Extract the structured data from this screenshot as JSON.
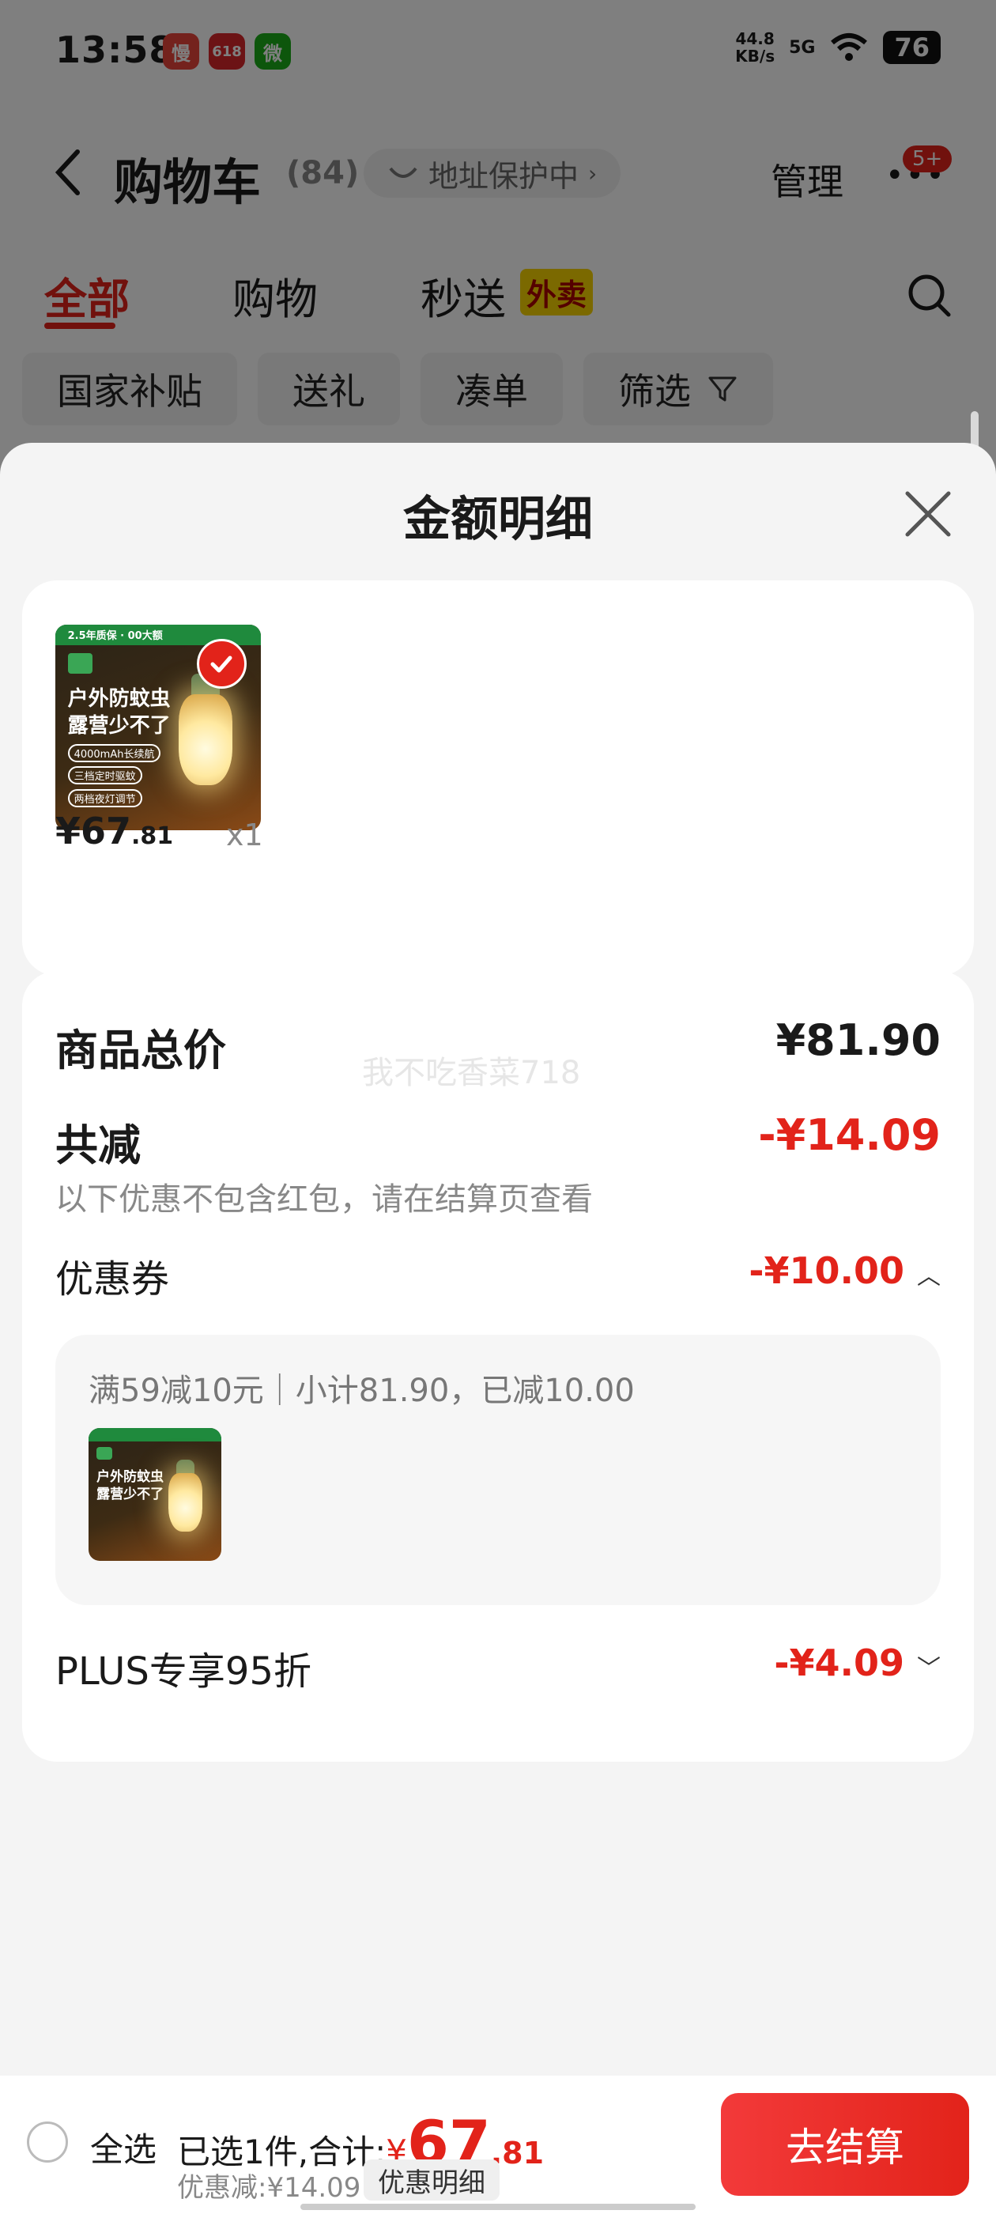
{
  "status_bar": {
    "time": "13:58",
    "apps": [
      {
        "icon": "manman-app-icon",
        "label": "慢",
        "color": "#e8443a"
      },
      {
        "icon": "jd-618-app-icon",
        "label": "618",
        "color": "#d8262b"
      },
      {
        "icon": "wechat-icon",
        "label": "微",
        "color": "#1aad19"
      }
    ],
    "net_speed_value": "44.8",
    "net_speed_unit": "KB/s",
    "signal_label": "5G",
    "battery": "76"
  },
  "nav": {
    "title": "购物车",
    "count": "(84)",
    "address_pill": "地址保护中",
    "manage": "管理",
    "more_badge": "5+"
  },
  "tabs": [
    {
      "label": "全部",
      "active": true
    },
    {
      "label": "购物",
      "active": false
    },
    {
      "label": "秒送",
      "active": false
    }
  ],
  "takeout_tag": "外卖",
  "filters": [
    "国家补贴",
    "送礼",
    "凑单",
    "筛选"
  ],
  "sheet": {
    "title": "金额明细",
    "product": {
      "image_lines": [
        "户外防蚊虫",
        "露营少不了"
      ],
      "image_tag1": "4000mAh长续航",
      "image_tag2": "三档定时驱蚊",
      "image_tag3": "两档夜灯调节",
      "image_top_text": "2.5年质保 · 00大额",
      "price_yen": "¥",
      "price_int": "67",
      "price_dec": ".81",
      "qty": "x1"
    },
    "total_label": "商品总价",
    "total_value": "¥81.90",
    "watermark": "我不吃香菜718",
    "reduce_label": "共减",
    "reduce_value": "-¥14.09",
    "reduce_note": "以下优惠不包含红包，请在结算页查看",
    "coupon_label": "优惠券",
    "coupon_value": "-¥10.00",
    "coupon_detail": "满59减10元｜小计81.90，已减10.00",
    "plus_label": "PLUS专享95折",
    "plus_value": "-¥4.09"
  },
  "bottom": {
    "select_all": "全选",
    "selected_prefix": "已选1件,合计:",
    "total_yen": "¥",
    "total_int": "67",
    "total_dec": ".81",
    "discount": "优惠减:¥14.09",
    "detail_button": "优惠明细",
    "checkout": "去结算"
  },
  "colors": {
    "accent": "#e2231a",
    "scrim": "rgba(0,0,0,0.5)",
    "sheet_bg": "#f4f4f4"
  }
}
